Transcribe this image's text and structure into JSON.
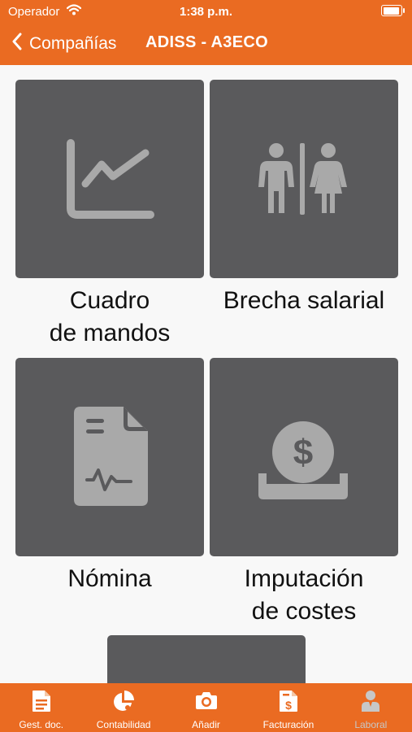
{
  "status_bar": {
    "carrier": "Operador",
    "time": "1:38 p.m."
  },
  "nav": {
    "back_label": "Compañías",
    "title": "ADISS - A3ECO"
  },
  "tiles": [
    {
      "label": "Cuadro\nde mandos",
      "icon": "line-chart-icon"
    },
    {
      "label": "Brecha salarial",
      "icon": "restroom-icon"
    },
    {
      "label": "Nómina",
      "icon": "payslip-icon"
    },
    {
      "label": "Imputación\nde costes",
      "icon": "coin-slot-icon"
    }
  ],
  "tabs": [
    {
      "label": "Gest. doc.",
      "icon": "document-icon",
      "active": true
    },
    {
      "label": "Contabilidad",
      "icon": "pie-chart-icon",
      "active": true
    },
    {
      "label": "Añadir",
      "icon": "camera-icon",
      "active": true
    },
    {
      "label": "Facturación",
      "icon": "invoice-icon",
      "active": true
    },
    {
      "label": "Laboral",
      "icon": "worker-icon",
      "active": false
    }
  ],
  "colors": {
    "brand": "#ea6b22",
    "tile": "#5a5a5c",
    "icon": "#a9a9a9",
    "tab_inactive": "#c7c7c7"
  }
}
